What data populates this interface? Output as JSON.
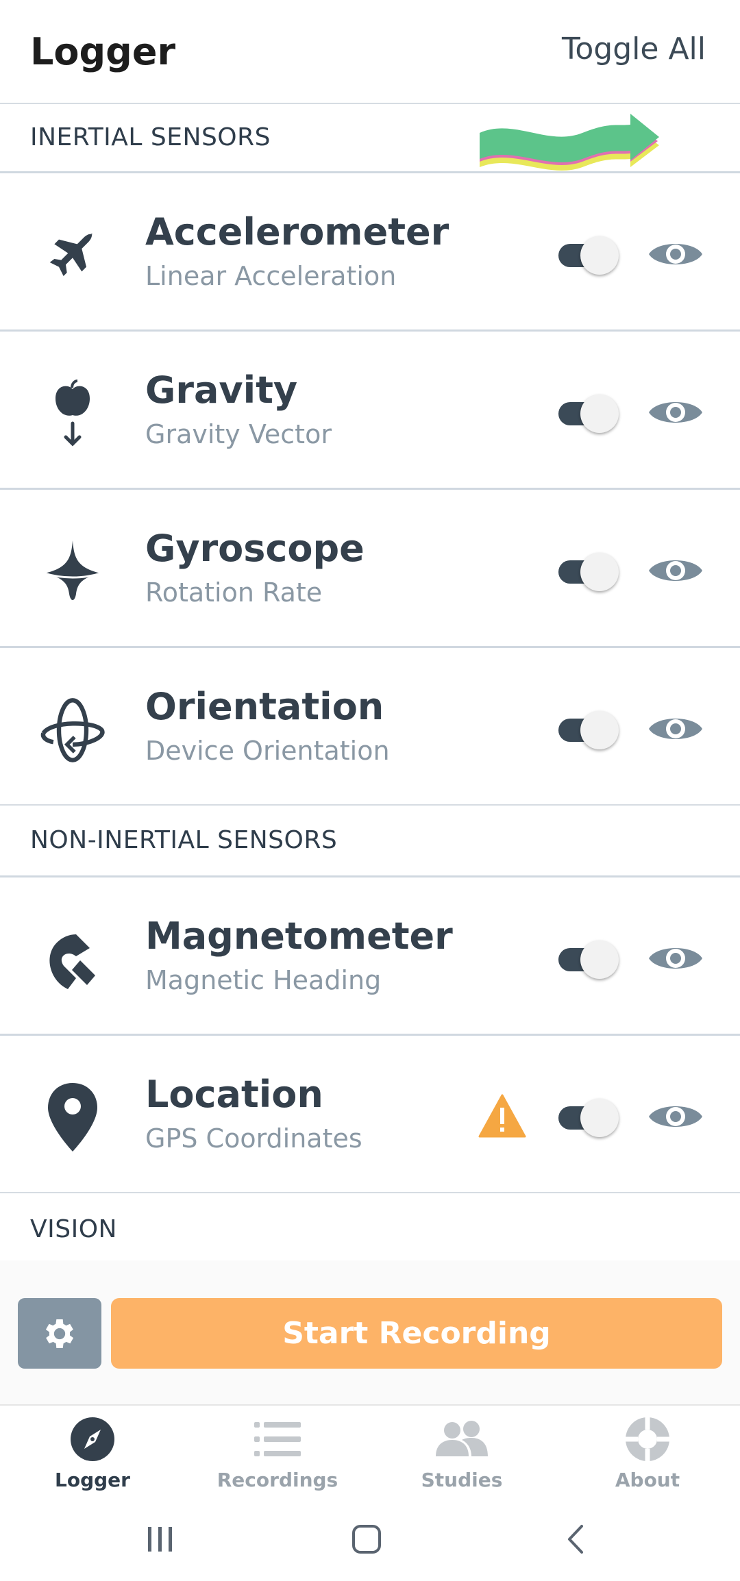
{
  "header": {
    "title": "Logger",
    "toggle_all": "Toggle All"
  },
  "sections": {
    "inertial": "INERTIAL SENSORS",
    "non_inertial": "NON-INERTIAL SENSORS",
    "vision": "VISION"
  },
  "sensors": [
    {
      "title": "Accelerometer",
      "subtitle": "Linear Acceleration",
      "icon": "airplane-icon",
      "enabled": true
    },
    {
      "title": "Gravity",
      "subtitle": "Gravity Vector",
      "icon": "apple-falling-icon",
      "enabled": true
    },
    {
      "title": "Gyroscope",
      "subtitle": "Rotation Rate",
      "icon": "spinning-top-icon",
      "enabled": true
    },
    {
      "title": "Orientation",
      "subtitle": "Device Orientation",
      "icon": "orbit-rotation-icon",
      "enabled": true
    },
    {
      "title": "Magnetometer",
      "subtitle": "Magnetic Heading",
      "icon": "magnet-icon",
      "enabled": true
    },
    {
      "title": "Location",
      "subtitle": "GPS Coordinates",
      "icon": "map-pin-icon",
      "enabled": true,
      "warning": true
    }
  ],
  "actions": {
    "start_recording": "Start Recording"
  },
  "nav": {
    "items": [
      {
        "label": "Logger",
        "icon": "compass-icon",
        "active": true
      },
      {
        "label": "Recordings",
        "icon": "list-icon",
        "active": false
      },
      {
        "label": "Studies",
        "icon": "users-icon",
        "active": false
      },
      {
        "label": "About",
        "icon": "lifebuoy-icon",
        "active": false
      }
    ]
  },
  "colors": {
    "accent": "#fdb367",
    "text_dark": "#2f3d4b",
    "text_muted": "#8a98a4",
    "switch_track": "#3b4a57",
    "eye": "#7a8c9a",
    "warning": "#f5a742"
  }
}
